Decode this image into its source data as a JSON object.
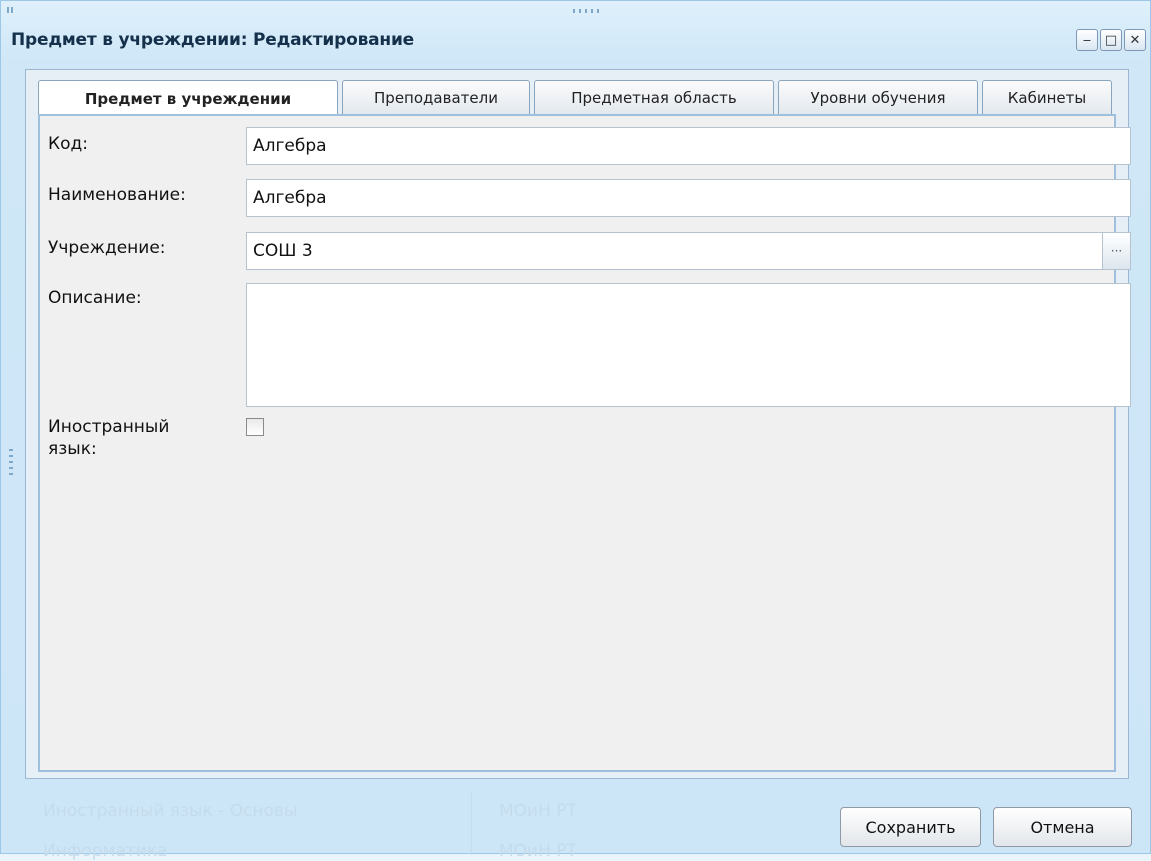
{
  "window": {
    "title": "Предмет в учреждении: Редактирование",
    "controls": {
      "minimize": "‒",
      "maximize": "□",
      "close": "✕"
    }
  },
  "tabs": [
    {
      "label": "Предмет в учреждении",
      "active": true
    },
    {
      "label": "Преподаватели",
      "active": false
    },
    {
      "label": "Предметная область",
      "active": false
    },
    {
      "label": "Уровни обучения",
      "active": false
    },
    {
      "label": "Кабинеты",
      "active": false
    }
  ],
  "form": {
    "code": {
      "label": "Код:",
      "value": "Алгебра"
    },
    "name": {
      "label": "Наименование:",
      "value": "Алгебра"
    },
    "institution": {
      "label": "Учреждение:",
      "value": "СОШ 3",
      "picker": "···"
    },
    "description": {
      "label": "Описание:",
      "value": ""
    },
    "foreign_language": {
      "label_line1": "Иностранный",
      "label_line2": "язык:",
      "checked": false
    }
  },
  "buttons": {
    "save": "Сохранить",
    "cancel": "Отмена"
  },
  "background": {
    "row1_name": "Иностранный язык - Основы",
    "row1_org": "МОиН РТ",
    "row2_name": "Информатика",
    "row2_org": "МОиН РТ"
  }
}
